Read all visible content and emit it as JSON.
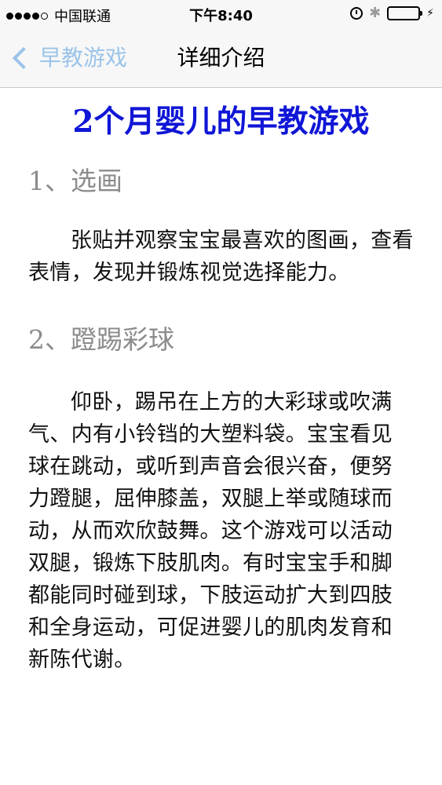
{
  "status_bar": {
    "carrier": "中国联通",
    "time": "下午8:40",
    "battery_color": "#4cd964"
  },
  "nav": {
    "back_label": "早教游戏",
    "title": "详细介绍"
  },
  "article": {
    "title": "2个月婴儿的早教游戏",
    "sections": [
      {
        "heading": "1、选画",
        "body": "张贴并观察宝宝最喜欢的图画，查看表情，发现并锻炼视觉选择能力。"
      },
      {
        "heading": "2、蹬踢彩球",
        "body": "仰卧，踢吊在上方的大彩球或吹满气、内有小铃铛的大塑料袋。宝宝看见球在跳动，或听到声音会很兴奋，便努力蹬腿，屈伸膝盖，双腿上举或随球而动，从而欢欣鼓舞。这个游戏可以活动双腿，锻炼下肢肌肉。有时宝宝手和脚都能同时碰到球，下肢运动扩大到四肢和全身运动，可促进婴儿的肌肉发育和新陈代谢。"
      }
    ]
  }
}
